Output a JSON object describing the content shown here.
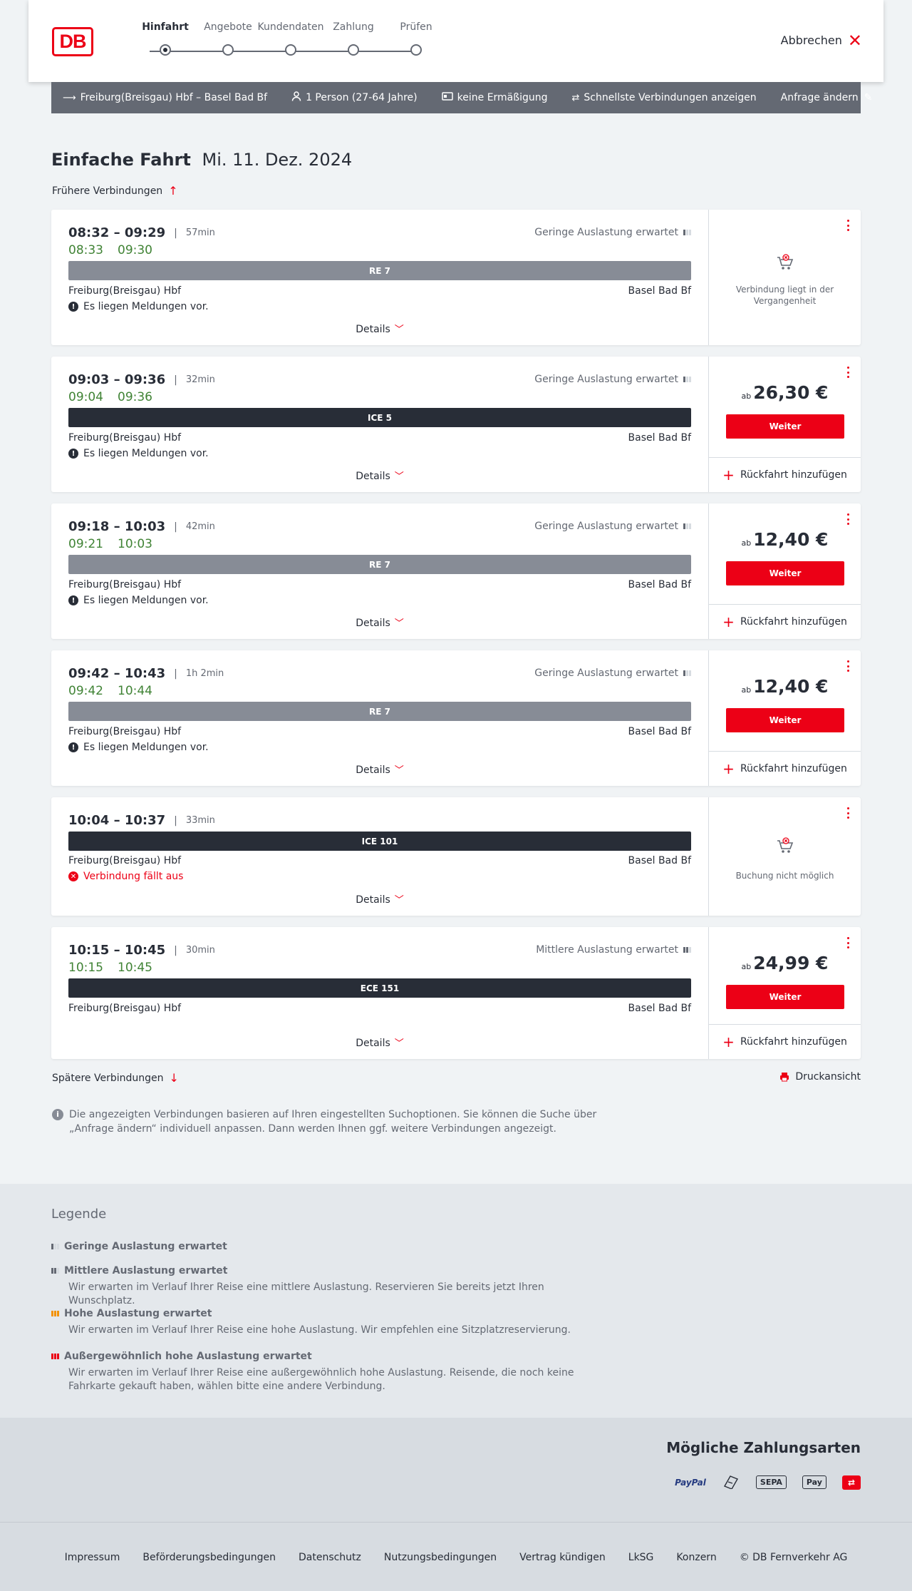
{
  "header": {
    "logo": "DB",
    "steps": [
      {
        "label": "Hinfahrt",
        "active": true
      },
      {
        "label": "Angebote",
        "active": false
      },
      {
        "label": "Kundendaten",
        "active": false
      },
      {
        "label": "Zahlung",
        "active": false
      },
      {
        "label": "Prüfen",
        "active": false
      }
    ],
    "cancel_label": "Abbrechen"
  },
  "summary": {
    "route": "Freiburg(Breisgau) Hbf – Basel Bad Bf",
    "travellers": "1 Person (27-64 Jahre)",
    "discount": "keine Ermäßigung",
    "option": "Schnellste Verbindungen anzeigen",
    "edit": "Anfrage ändern"
  },
  "title": {
    "type": "Einfache Fahrt",
    "date": "Mi. 11. Dez. 2024"
  },
  "earlier_label": "Frühere Verbindungen",
  "later_label": "Spätere Verbindungen",
  "print_label": "Druckansicht",
  "details_label": "Details",
  "weiter_label": "Weiter",
  "return_label": "Rückfahrt hinzufügen",
  "price_prefix": "ab",
  "connections": [
    {
      "times": "08:32 – 09:29",
      "duration": "57min",
      "rt_dep": "08:33",
      "rt_arr": "09:30",
      "load": "Geringe Auslastung erwartet",
      "train": "RE 7",
      "train_color": "#878c96",
      "from": "Freiburg(Breisgau) Hbf",
      "to": "Basel Bad Bf",
      "message": "Es liegen Meldungen vor.",
      "status": "Verbindung liegt in der Vergangenheit"
    },
    {
      "times": "09:03 – 09:36",
      "duration": "32min",
      "rt_dep": "09:04",
      "rt_arr": "09:36",
      "load": "Geringe Auslastung erwartet",
      "train": "ICE 5",
      "train_color": "#282d37",
      "from": "Freiburg(Breisgau) Hbf",
      "to": "Basel Bad Bf",
      "message": "Es liegen Meldungen vor.",
      "price": "26,30 €"
    },
    {
      "times": "09:18 – 10:03",
      "duration": "42min",
      "rt_dep": "09:21",
      "rt_arr": "10:03",
      "load": "Geringe Auslastung erwartet",
      "train": "RE 7",
      "train_color": "#878c96",
      "from": "Freiburg(Breisgau) Hbf",
      "to": "Basel Bad Bf",
      "message": "Es liegen Meldungen vor.",
      "price": "12,40 €"
    },
    {
      "times": "09:42 – 10:43",
      "duration": "1h 2min",
      "rt_dep": "09:42",
      "rt_arr": "10:44",
      "load": "Geringe Auslastung erwartet",
      "train": "RE 7",
      "train_color": "#878c96",
      "from": "Freiburg(Breisgau) Hbf",
      "to": "Basel Bad Bf",
      "message": "Es liegen Meldungen vor.",
      "price": "12,40 €"
    },
    {
      "times": "10:04 – 10:37",
      "duration": "33min",
      "train": "ICE 101",
      "train_color": "#282d37",
      "from": "Freiburg(Breisgau) Hbf",
      "to": "Basel Bad Bf",
      "message": "Verbindung fällt aus",
      "status": "Buchung nicht möglich"
    },
    {
      "times": "10:15 – 10:45",
      "duration": "30min",
      "rt_dep": "10:15",
      "rt_arr": "10:45",
      "load": "Mittlere Auslastung erwartet",
      "train": "ECE 151",
      "train_color": "#282d37",
      "from": "Freiburg(Breisgau) Hbf",
      "to": "Basel Bad Bf",
      "price": "24,99 €"
    }
  ],
  "info_note": "Die angezeigten Verbindungen basieren auf Ihren eingestellten Suchoptionen. Sie können die Suche über „Anfrage ändern“ individuell anpassen. Dann werden Ihnen ggf. weitere Verbindungen angezeigt.",
  "legend": {
    "title": "Legende",
    "items": [
      {
        "head": "Geringe Auslastung erwartet",
        "desc": ""
      },
      {
        "head": "Mittlere Auslastung erwartet",
        "desc": "Wir erwarten im Verlauf Ihrer Reise eine mittlere Auslastung. Reservieren Sie bereits jetzt Ihren Wunschplatz."
      },
      {
        "head": "Hohe Auslastung erwartet",
        "desc": "Wir erwarten im Verlauf Ihrer Reise eine hohe Auslastung. Wir empfehlen eine Sitzplatzreservierung."
      },
      {
        "head": "Außergewöhnlich hohe Auslastung erwartet",
        "desc": "Wir erwarten im Verlauf Ihrer Reise eine außergewöhnlich hohe Auslastung. Reisende, die noch keine Fahrkarte gekauft haben, wählen bitte eine andere Verbindung."
      }
    ]
  },
  "payment": {
    "title": "Mögliche Zahlungsarten",
    "methods": [
      "PayPal",
      "SEPA",
      "Pay"
    ]
  },
  "footer": {
    "links": [
      "Impressum",
      "Beförderungsbedingungen",
      "Datenschutz",
      "Nutzungsbedingungen",
      "Vertrag kündigen",
      "LkSG",
      "Konzern",
      "© DB Fernverkehr AG"
    ]
  },
  "colors": {
    "accent": "#ec0016",
    "realtime": "#408335",
    "bar": "#646973"
  }
}
